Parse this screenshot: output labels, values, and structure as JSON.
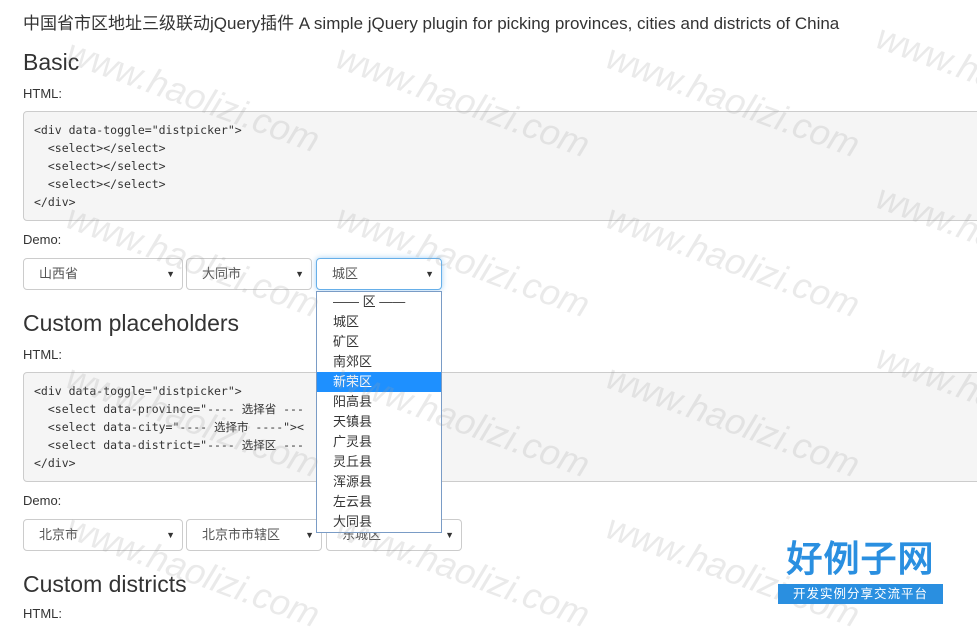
{
  "page": {
    "title": "中国省市区地址三级联动jQuery插件 A simple jQuery plugin for picking provinces, cities and districts of China"
  },
  "basic": {
    "heading": "Basic",
    "html_label": "HTML:",
    "code": "<div data-toggle=\"distpicker\">\n  <select></select>\n  <select></select>\n  <select></select>\n</div>",
    "demo_label": "Demo:",
    "province": "山西省",
    "city": "大同市",
    "district": "城区"
  },
  "district_dropdown": {
    "options": [
      "—— 区 ——",
      "城区",
      "矿区",
      "南郊区",
      "新荣区",
      "阳高县",
      "天镇县",
      "广灵县",
      "灵丘县",
      "浑源县",
      "左云县",
      "大同县"
    ],
    "highlighted_index": 4,
    "highlight_color": "#1e90ff"
  },
  "custom_placeholders": {
    "heading": "Custom placeholders",
    "html_label": "HTML:",
    "code": "<div data-toggle=\"distpicker\">\n  <select data-province=\"---- 选择省 ---\n  <select data-city=\"---- 选择市 ----\"><\n  <select data-district=\"---- 选择区 ---\n</div>",
    "demo_label": "Demo:",
    "province": "北京市",
    "city": "北京市市辖区",
    "district": "东城区"
  },
  "custom_districts": {
    "heading": "Custom districts",
    "html_label": "HTML:"
  },
  "watermark": {
    "text": "www.haolizi.com"
  },
  "logo": {
    "main": "好例子网",
    "sub": "开发实例分享交流平台",
    "color": "#2a8fe0"
  }
}
